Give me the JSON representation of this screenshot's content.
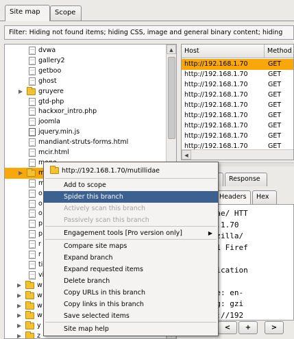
{
  "tabs": [
    {
      "label": "Site map",
      "active": true
    },
    {
      "label": "Scope",
      "active": false
    }
  ],
  "filter_text": "Filter:  Hiding not found items;  hiding CSS, image and general binary content;  hiding",
  "tree": {
    "items": [
      {
        "label": "dvwa",
        "type": "file"
      },
      {
        "label": "gallery2",
        "type": "file"
      },
      {
        "label": "getboo",
        "type": "file"
      },
      {
        "label": "ghost",
        "type": "file"
      },
      {
        "label": "gruyere",
        "type": "folder"
      },
      {
        "label": "gtd-php",
        "type": "file"
      },
      {
        "label": "hackxor_intro.php",
        "type": "file"
      },
      {
        "label": "joomla",
        "type": "file"
      },
      {
        "label": "jquery.min.js",
        "type": "js"
      },
      {
        "label": "mandiant-struts-forms.html",
        "type": "file"
      },
      {
        "label": "mcir.html",
        "type": "file"
      },
      {
        "label": "mono",
        "type": "file"
      },
      {
        "label": "m",
        "type": "folder",
        "selected": true
      },
      {
        "label": "m",
        "type": "file"
      },
      {
        "label": "o",
        "type": "file"
      },
      {
        "label": "o",
        "type": "file"
      },
      {
        "label": "o",
        "type": "file"
      },
      {
        "label": "p",
        "type": "file"
      },
      {
        "label": "p",
        "type": "file"
      },
      {
        "label": "r",
        "type": "file"
      },
      {
        "label": "r",
        "type": "file"
      },
      {
        "label": "ti",
        "type": "file"
      },
      {
        "label": "vi",
        "type": "file"
      },
      {
        "label": "w",
        "type": "folder"
      },
      {
        "label": "w",
        "type": "folder"
      },
      {
        "label": "w",
        "type": "folder"
      },
      {
        "label": "w",
        "type": "folder"
      },
      {
        "label": "y",
        "type": "folder"
      },
      {
        "label": "z",
        "type": "folder"
      }
    ]
  },
  "table": {
    "columns": [
      "Host",
      "Method"
    ],
    "rows": [
      {
        "host": "http://192.168.1.70",
        "method": "GET"
      },
      {
        "host": "http://192.168.1.70",
        "method": "GET"
      },
      {
        "host": "http://192.168.1.70",
        "method": "GET"
      },
      {
        "host": "http://192.168.1.70",
        "method": "GET"
      },
      {
        "host": "http://192.168.1.70",
        "method": "GET"
      },
      {
        "host": "http://192.168.1.70",
        "method": "GET"
      },
      {
        "host": "http://192.168.1.70",
        "method": "GET"
      },
      {
        "host": "http://192.168.1.70",
        "method": "GET"
      },
      {
        "host": "http://192.168.1.70",
        "method": "GET"
      }
    ]
  },
  "message_tabs": {
    "top": [
      "t",
      "Response"
    ],
    "bottom": [
      "Headers",
      "Hex"
    ]
  },
  "message_lines": [
    "utillidae/ HTT",
    "192.168.1.70",
    "ent: Mozilla/",
    "20100101 Firef",
    "",
    "ml,application",
    "",
    "Language: en-",
    "Encoding: gzi",
    "e: http://192"
  ],
  "nav_buttons": [
    "<",
    "+",
    ">"
  ],
  "context_menu": {
    "header": "http://192.168.1.70/mutillidae",
    "items": [
      {
        "label": "Add to scope"
      },
      {
        "label": "Spider this branch",
        "highlighted": true
      },
      {
        "label": "Actively scan this branch",
        "disabled": true
      },
      {
        "label": "Passively scan this branch",
        "disabled": true
      },
      {
        "label": "Engagement tools [Pro version only]",
        "submenu": true
      },
      {
        "label": "Compare site maps"
      },
      {
        "label": "Expand branch"
      },
      {
        "label": "Expand requested items"
      },
      {
        "label": "Delete branch"
      },
      {
        "label": "Copy URLs in this branch"
      },
      {
        "label": "Copy links in this branch"
      },
      {
        "label": "Save selected items"
      },
      {
        "label": "Site map help"
      }
    ]
  },
  "colors": {
    "selection_orange": "#f9a80b",
    "menu_highlight": "#3c6090",
    "folder_yellow": "#f2c230"
  }
}
